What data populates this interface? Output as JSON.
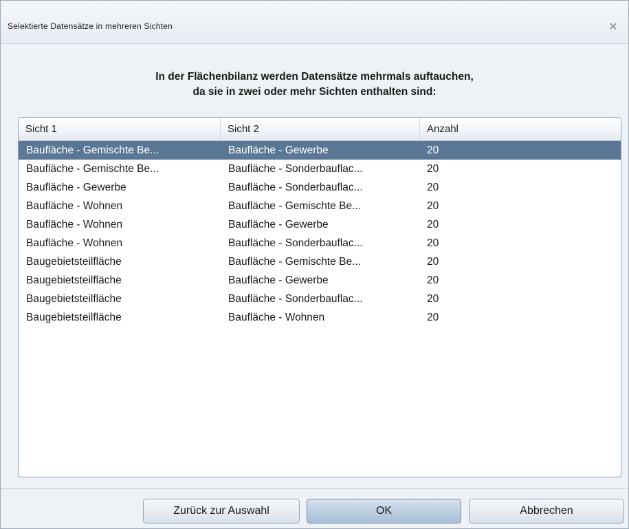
{
  "window": {
    "title": "Selektierte Datensätze in mehreren Sichten",
    "close_icon": "close-icon"
  },
  "message": {
    "line1": "In der Flächenbilanz werden Datensätze mehrmals auftauchen,",
    "line2": "da sie in zwei oder mehr Sichten enthalten sind:"
  },
  "table": {
    "columns": [
      "Sicht 1",
      "Sicht 2",
      "Anzahl"
    ],
    "selected_row": 0,
    "rows": [
      [
        "Baufläche - Gemischte Be...",
        "Baufläche - Gewerbe",
        "20"
      ],
      [
        "Baufläche - Gemischte Be...",
        "Baufläche - Sonderbauflac...",
        "20"
      ],
      [
        "Baufläche - Gewerbe",
        "Baufläche - Sonderbauflac...",
        "20"
      ],
      [
        "Baufläche - Wohnen",
        "Baufläche - Gemischte Be...",
        "20"
      ],
      [
        "Baufläche - Wohnen",
        "Baufläche - Gewerbe",
        "20"
      ],
      [
        "Baufläche - Wohnen",
        "Baufläche - Sonderbauflac...",
        "20"
      ],
      [
        "Baugebietsteilfläche",
        "Baufläche - Gemischte Be...",
        "20"
      ],
      [
        "Baugebietsteilfläche",
        "Baufläche - Gewerbe",
        "20"
      ],
      [
        "Baugebietsteilfläche",
        "Baufläche - Sonderbauflac...",
        "20"
      ],
      [
        "Baugebietsteilfläche",
        "Baufläche - Wohnen",
        "20"
      ]
    ]
  },
  "buttons": {
    "back_label": "Zurück zur Auswahl",
    "ok_label": "OK",
    "cancel_label": "Abbrechen"
  },
  "colors": {
    "selection": "#5b7796",
    "window_bg": "#eef1f5"
  }
}
